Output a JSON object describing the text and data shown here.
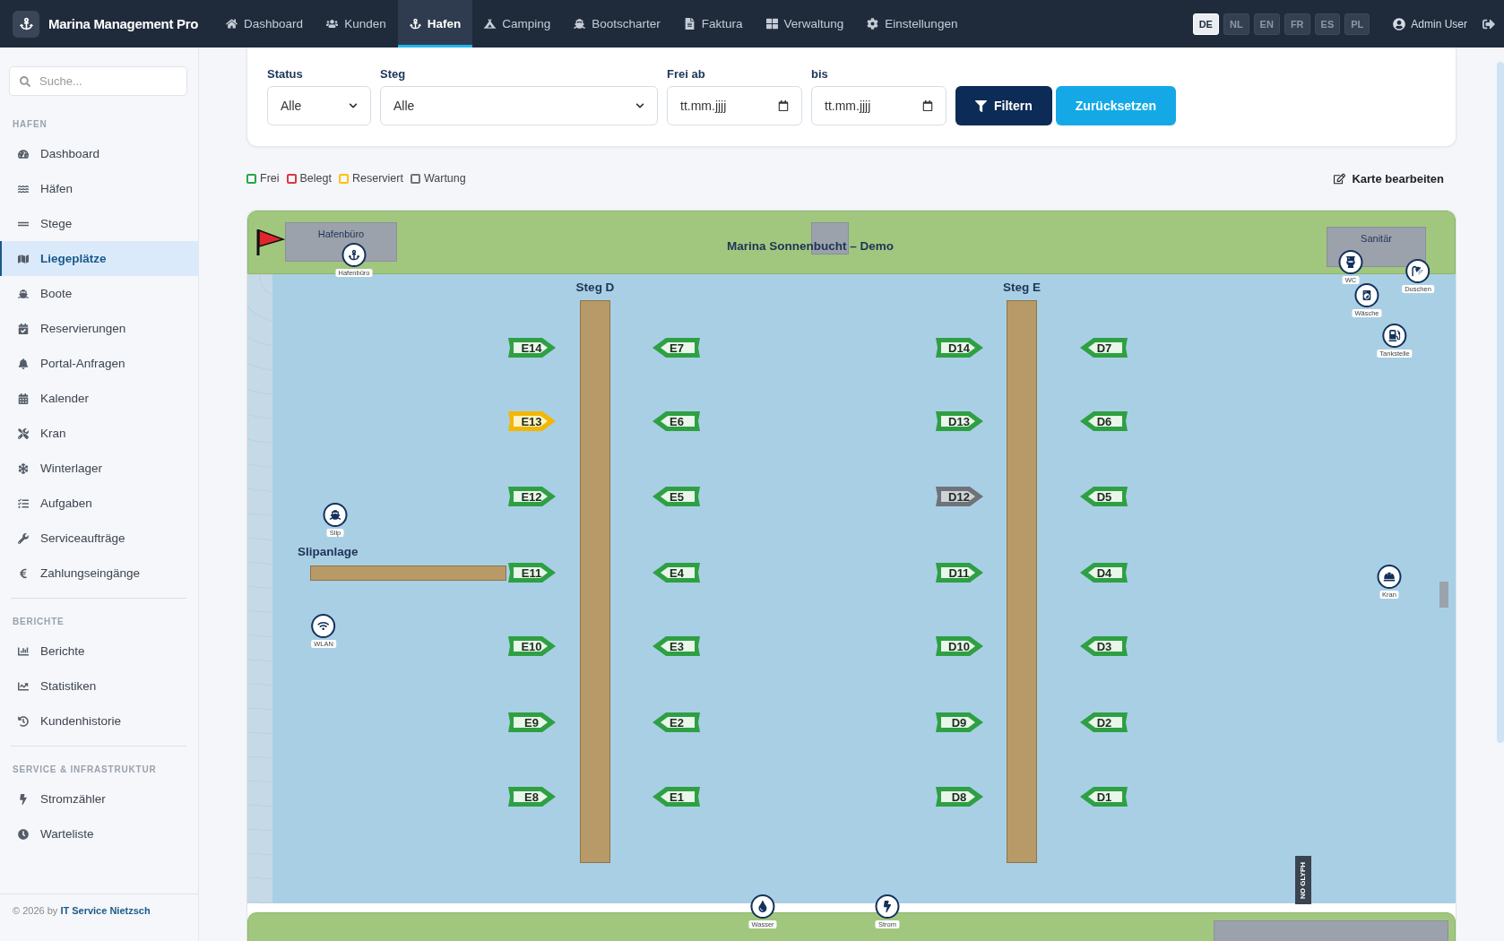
{
  "header": {
    "app_name": "Marina Management Pro",
    "nav": [
      {
        "label": "Dashboard",
        "selected": false
      },
      {
        "label": "Kunden",
        "selected": false
      },
      {
        "label": "Hafen",
        "selected": true
      },
      {
        "label": "Camping",
        "selected": false
      },
      {
        "label": "Bootscharter",
        "selected": false
      },
      {
        "label": "Faktura",
        "selected": false
      },
      {
        "label": "Verwaltung",
        "selected": false
      },
      {
        "label": "Einstellungen",
        "selected": false
      }
    ],
    "languages": [
      {
        "label": "DE",
        "selected": true
      },
      {
        "label": "NL",
        "selected": false
      },
      {
        "label": "EN",
        "selected": false
      },
      {
        "label": "FR",
        "selected": false
      },
      {
        "label": "ES",
        "selected": false
      },
      {
        "label": "PL",
        "selected": false
      }
    ],
    "user": "Admin User"
  },
  "sidebar": {
    "search_placeholder": "Suche...",
    "sections": [
      {
        "title": "HAFEN",
        "items": [
          {
            "label": "Dashboard",
            "selected": false
          },
          {
            "label": "Häfen",
            "selected": false
          },
          {
            "label": "Stege",
            "selected": false
          },
          {
            "label": "Liegeplätze",
            "selected": true
          },
          {
            "label": "Boote",
            "selected": false
          },
          {
            "label": "Reservierungen",
            "selected": false
          },
          {
            "label": "Portal-Anfragen",
            "selected": false
          },
          {
            "label": "Kalender",
            "selected": false
          },
          {
            "label": "Kran",
            "selected": false
          },
          {
            "label": "Winterlager",
            "selected": false
          },
          {
            "label": "Aufgaben",
            "selected": false
          },
          {
            "label": "Serviceaufträge",
            "selected": false
          },
          {
            "label": "Zahlungseingänge",
            "selected": false
          }
        ]
      },
      {
        "title": "BERICHTE",
        "items": [
          {
            "label": "Berichte",
            "selected": false
          },
          {
            "label": "Statistiken",
            "selected": false
          },
          {
            "label": "Kundenhistorie",
            "selected": false
          }
        ]
      },
      {
        "title": "SERVICE & INFRASTRUKTUR",
        "items": [
          {
            "label": "Stromzähler",
            "selected": false
          },
          {
            "label": "Warteliste",
            "selected": false
          }
        ]
      }
    ],
    "footer": {
      "text": "© 2026 by",
      "link": "IT Service Nietzsch"
    }
  },
  "filters": {
    "status": {
      "label": "Status",
      "value": "Alle"
    },
    "steg": {
      "label": "Steg",
      "value": "Alle"
    },
    "from": {
      "label": "Frei ab",
      "placeholder": "tt.mm.jjjj"
    },
    "to": {
      "label": "bis",
      "placeholder": "tt.mm.jjjj"
    },
    "filter_button": "Filtern",
    "reset_button": "Zurücksetzen"
  },
  "legend": [
    {
      "label": "Frei",
      "color": "#28a745"
    },
    {
      "label": "Belegt",
      "color": "#dc3545"
    },
    {
      "label": "Reserviert",
      "color": "#ffc107"
    },
    {
      "label": "Wartung",
      "color": "#6c757d"
    }
  ],
  "edit_map_link": "Karte bearbeiten",
  "map": {
    "title": "Marina Sonnenbucht – Demo",
    "buildings": [
      "Hafenbüro",
      "Sanitär"
    ],
    "piers": [
      {
        "label": "Steg D",
        "left": [
          {
            "label": "E14",
            "kind": "free"
          },
          {
            "label": "E13",
            "kind": "reserved"
          },
          {
            "label": "E12",
            "kind": "free"
          },
          {
            "label": "E11",
            "kind": "free"
          },
          {
            "label": "E10",
            "kind": "free"
          },
          {
            "label": "E9",
            "kind": "free"
          },
          {
            "label": "E8",
            "kind": "free"
          }
        ],
        "right": [
          {
            "label": "E7",
            "kind": "free"
          },
          {
            "label": "E6",
            "kind": "free"
          },
          {
            "label": "E5",
            "kind": "free"
          },
          {
            "label": "E4",
            "kind": "free"
          },
          {
            "label": "E3",
            "kind": "free"
          },
          {
            "label": "E2",
            "kind": "free"
          },
          {
            "label": "E1",
            "kind": "free"
          }
        ]
      },
      {
        "label": "Steg E",
        "left": [
          {
            "label": "D14",
            "kind": "free"
          },
          {
            "label": "D13",
            "kind": "free"
          },
          {
            "label": "D12",
            "kind": "maintenance"
          },
          {
            "label": "D11",
            "kind": "free"
          },
          {
            "label": "D10",
            "kind": "free"
          },
          {
            "label": "D9",
            "kind": "free"
          },
          {
            "label": "D8",
            "kind": "free"
          }
        ],
        "right": [
          {
            "label": "D7",
            "kind": "free"
          },
          {
            "label": "D6",
            "kind": "free"
          },
          {
            "label": "D5",
            "kind": "free"
          },
          {
            "label": "D4",
            "kind": "free"
          },
          {
            "label": "D3",
            "kind": "free"
          },
          {
            "label": "D2",
            "kind": "free"
          },
          {
            "label": "D1",
            "kind": "free"
          }
        ]
      }
    ],
    "slip_label": "Slipanlage",
    "amenities": [
      "Hafenbüro",
      "WC",
      "Duschen",
      "Wäsche",
      "Tankstelle",
      "Kran",
      "WLAN",
      "Slip",
      "Wasser",
      "Strom"
    ],
    "sign": "NO GLYPH"
  }
}
